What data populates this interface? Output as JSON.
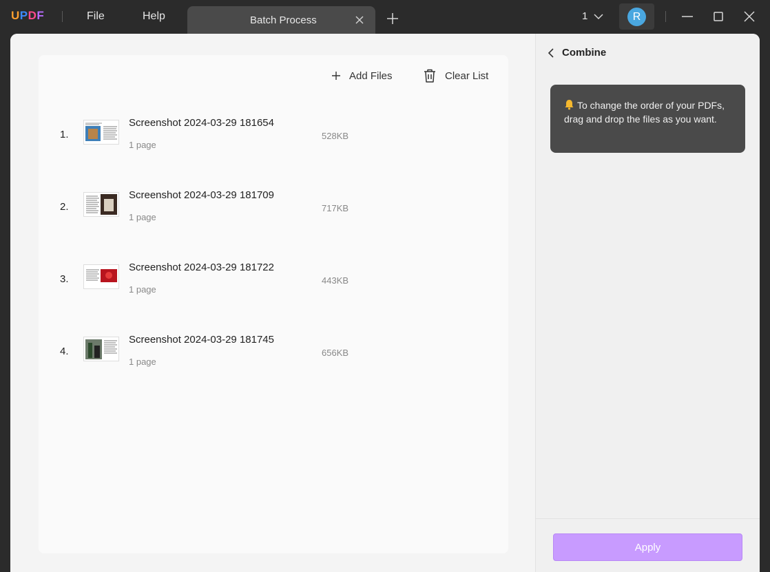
{
  "app": {
    "logo_letters": [
      "U",
      "P",
      "D",
      "F"
    ],
    "logo_colors": [
      "#ff9f2e",
      "#3b8bff",
      "#ff4a8e",
      "#b86cff"
    ],
    "menu": {
      "file": "File",
      "help": "Help"
    },
    "tab": {
      "title": "Batch Process"
    },
    "window_count": "1",
    "avatar_letter": "R"
  },
  "toolbar": {
    "add_files_label": "Add Files",
    "clear_list_label": "Clear List"
  },
  "files": [
    {
      "index": "1.",
      "name": "Screenshot 2024-03-29 181654",
      "pages": "1 page",
      "size": "528KB"
    },
    {
      "index": "2.",
      "name": "Screenshot 2024-03-29 181709",
      "pages": "1 page",
      "size": "717KB"
    },
    {
      "index": "3.",
      "name": "Screenshot 2024-03-29 181722",
      "pages": "1 page",
      "size": "443KB"
    },
    {
      "index": "4.",
      "name": "Screenshot 2024-03-29 181745",
      "pages": "1 page",
      "size": "656KB"
    }
  ],
  "panel": {
    "title": "Combine",
    "tip_text": "To change the order of your PDFs, drag and drop the files as you want.",
    "apply_label": "Apply"
  },
  "colors": {
    "accent": "#c89bff",
    "avatar": "#4aa7e0",
    "tip_bg": "#4a4a4a"
  }
}
